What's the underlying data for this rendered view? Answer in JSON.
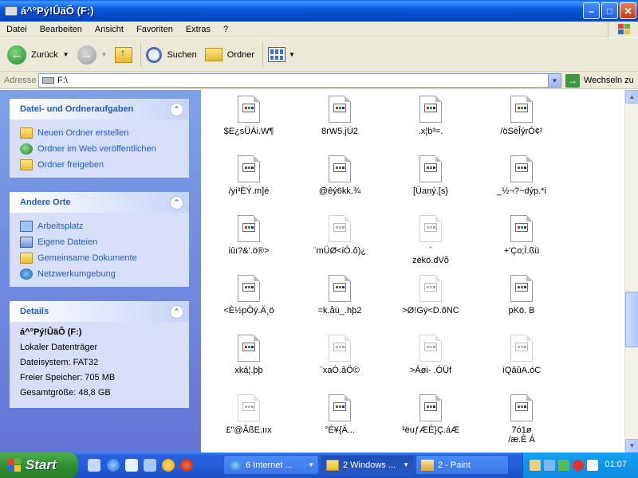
{
  "window": {
    "title": "á\u0004^°Pý!\u0005ÛäÕ (F:)",
    "controls": [
      "minimize",
      "maximize",
      "close"
    ]
  },
  "menu": [
    "Datei",
    "Bearbeiten",
    "Ansicht",
    "Favoriten",
    "Extras",
    "?"
  ],
  "toolbar": {
    "back_label": "Zurück",
    "search_label": "Suchen",
    "folders_label": "Ordner"
  },
  "address": {
    "label": "Adresse",
    "value": "F:\\",
    "go_label": "Wechseln zu"
  },
  "tasks_panel": {
    "title": "Datei- und Ordneraufgaben",
    "items": [
      "Neuen Ordner erstellen",
      "Ordner im Web veröffentlichen",
      "Ordner freigeben"
    ]
  },
  "places_panel": {
    "title": "Andere Orte",
    "items": [
      "Arbeitsplatz",
      "Eigene Dateien",
      "Gemeinsame Dokumente",
      "Netzwerkumgebung"
    ]
  },
  "details_panel": {
    "title": "Details",
    "name": "á\u0004^°Pý!\u0005ÛäÕ (F:)",
    "type": "Lokaler Datenträger",
    "filesystem": "Dateisystem: FAT32",
    "free": "Freier Speicher: 705 MB",
    "total": "Gesamtgröße: 48,8 GB"
  },
  "files": [
    "$E¿\u0005sÜÁi.W\u0005¶",
    "8rW\u0005\u00055\u0005.jÜ2",
    ".\u0005x\u0005¦b³=.\u0005\u0005\u0005",
    "/öSë\u0005ÎýrÓ¢²",
    "/yi³\u0005È\u0005Ý.m]é",
    "@êý6kk\u0005.\u0005\u0005¾",
    "[Üan\u0005ý\u0005.[s}",
    "_½¬?~dýp.\u0005*i",
    "iû\u0005ı?\u0005&'.ö®>",
    "¨mÜ\u0005Ø<iÓ.ô)¿",
    "´\u0005\nzë\u0005kö.dVõ",
    "+'Ço;\u0005\u0005Ì.ßü\u0005",
    "<È½p\u0005Öý\u0005.Ä¸ö",
    "=k\u0005.\u0005åù_.hþ2",
    ">Ø!G\u0005ý<D.õNC",
    "\u0005\u0005p\u0005K\u0005ó\u0005. B\u0005",
    "\u0005\u0005xkâ\u0005\u0005¦.þ\u0005þ",
    "\u0005\u0005¨xa\u0005\u0005Ò.ãÖ©",
    "\u0005>\u0005Áøi- .ÒÜf",
    "\u0005\u0005íQ\u0005âûA.óC\u0005",
    "£\"\u0005@\u0005ÂßE.ııx",
    "°\u0005\u0005É¥\u0005{Ä...",
    "³ëuƒÆÉ}Ç.\u0005áÆ",
    "7ó\u00051ø\n/æ.È Á"
  ],
  "taskbar": {
    "start_label": "Start",
    "tasks": [
      "6 Internet ...",
      "2 Windows ...",
      "2 - Paint"
    ],
    "clock": "01:07"
  }
}
